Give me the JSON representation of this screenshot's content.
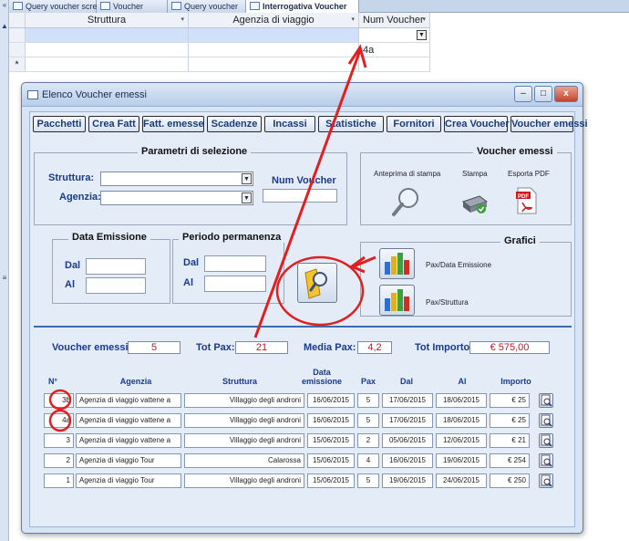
{
  "tabs": [
    "Query voucher screnati",
    "Voucher",
    "Query voucher",
    "Interrogativa Voucher"
  ],
  "grid": {
    "headers": [
      "Struttura",
      "Agenzia di viaggio",
      "Num Voucher"
    ],
    "value_row": "4a",
    "new_row_marker": "*"
  },
  "window": {
    "title": "Elenco Voucher emessi"
  },
  "toolbar": [
    "Pacchetti",
    "Crea Fatt",
    "Fatt. emesse",
    "Scadenze",
    "Incassi",
    "Statistiche",
    "Fornitori",
    "Crea Voucher",
    "Voucher emessi"
  ],
  "params": {
    "title": "Parametri di selezione",
    "struttura_label": "Struttura:",
    "agenzia_label": "Agenzia:",
    "num_voucher_label": "Num Voucher"
  },
  "voucher_out": {
    "title": "Voucher emessi",
    "preview": "Anteprima di stampa",
    "print": "Stampa",
    "pdf": "Esporta PDF",
    "pdf_badge": "PDF"
  },
  "emissione": {
    "title": "Data Emissione",
    "dal": "Dal",
    "al": "Al"
  },
  "permanenza": {
    "title": "Periodo permanenza",
    "dal": "Dal",
    "al": "Al"
  },
  "grafici": {
    "title": "Grafici",
    "pax_data": "Pax/Data Emissione",
    "pax_struttura": "Pax/Struttura"
  },
  "summary": {
    "emessi_label": "Voucher emessi:",
    "emessi": "5",
    "pax_label": "Tot Pax:",
    "pax": "21",
    "media_label": "Media Pax:",
    "media": "4,2",
    "importo_label": "Tot Importo:",
    "importo": "€ 575,00"
  },
  "columns": [
    "N°",
    "Agenzia",
    "Struttura",
    "Data\nemissione",
    "Pax",
    "Dal",
    "Al",
    "Importo"
  ],
  "rows": [
    {
      "n": "3b",
      "agenzia": "Agenzia di viaggio vattene a",
      "struttura": "Villaggio degli androni",
      "emissione": "16/06/2015",
      "pax": "5",
      "dal": "17/06/2015",
      "al": "18/06/2015",
      "importo": "€ 25"
    },
    {
      "n": "4a",
      "agenzia": "Agenzia di viaggio vattene a",
      "struttura": "Villaggio degli androni",
      "emissione": "16/06/2015",
      "pax": "5",
      "dal": "17/06/2015",
      "al": "18/06/2015",
      "importo": "€ 25"
    },
    {
      "n": "3",
      "agenzia": "Agenzia di viaggio vattene a",
      "struttura": "Villaggio degli androni",
      "emissione": "15/06/2015",
      "pax": "2",
      "dal": "05/06/2015",
      "al": "12/06/2015",
      "importo": "€ 21"
    },
    {
      "n": "2",
      "agenzia": "Agenzia di viaggio Tour",
      "struttura": "Calarossa",
      "emissione": "15/06/2015",
      "pax": "4",
      "dal": "16/06/2015",
      "al": "19/06/2015",
      "importo": "€ 254"
    },
    {
      "n": "1",
      "agenzia": "Agenzia di viaggio Tour",
      "struttura": "Villaggio degli androni",
      "emissione": "15/06/2015",
      "pax": "5",
      "dal": "19/06/2015",
      "al": "24/06/2015",
      "importo": "€ 250"
    }
  ],
  "colors": {
    "label_blue": "#1a3a8c",
    "value_red": "#c8141e",
    "annotation_red": "#e02020",
    "separator": "#3a6ab0"
  }
}
